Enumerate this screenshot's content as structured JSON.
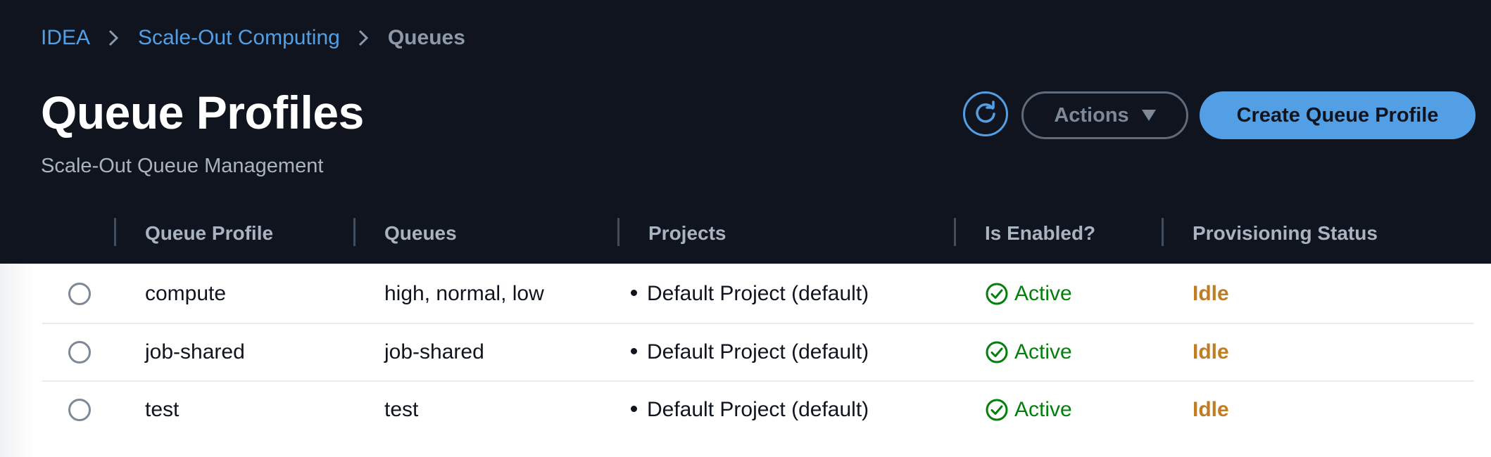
{
  "breadcrumb": {
    "items": [
      "IDEA",
      "Scale-Out Computing",
      "Queues"
    ]
  },
  "page": {
    "title": "Queue Profiles",
    "subtitle": "Scale-Out Queue Management"
  },
  "toolbar": {
    "refresh_icon": "refresh-icon",
    "actions_label": "Actions",
    "create_label": "Create Queue Profile"
  },
  "table": {
    "columns": [
      "Queue Profile",
      "Queues",
      "Projects",
      "Is Enabled?",
      "Provisioning Status"
    ],
    "rows": [
      {
        "queue_profile": "compute",
        "queues": "high, normal, low",
        "project": "Default Project (default)",
        "enabled": "Active",
        "status": "Idle"
      },
      {
        "queue_profile": "job-shared",
        "queues": "job-shared",
        "project": "Default Project (default)",
        "enabled": "Active",
        "status": "Idle"
      },
      {
        "queue_profile": "test",
        "queues": "test",
        "project": "Default Project (default)",
        "enabled": "Active",
        "status": "Idle"
      }
    ]
  },
  "colors": {
    "header_bg": "#0f141f",
    "link": "#539fe5",
    "primary_button": "#539fe5",
    "active": "#037f0c",
    "idle": "#c07d24"
  }
}
